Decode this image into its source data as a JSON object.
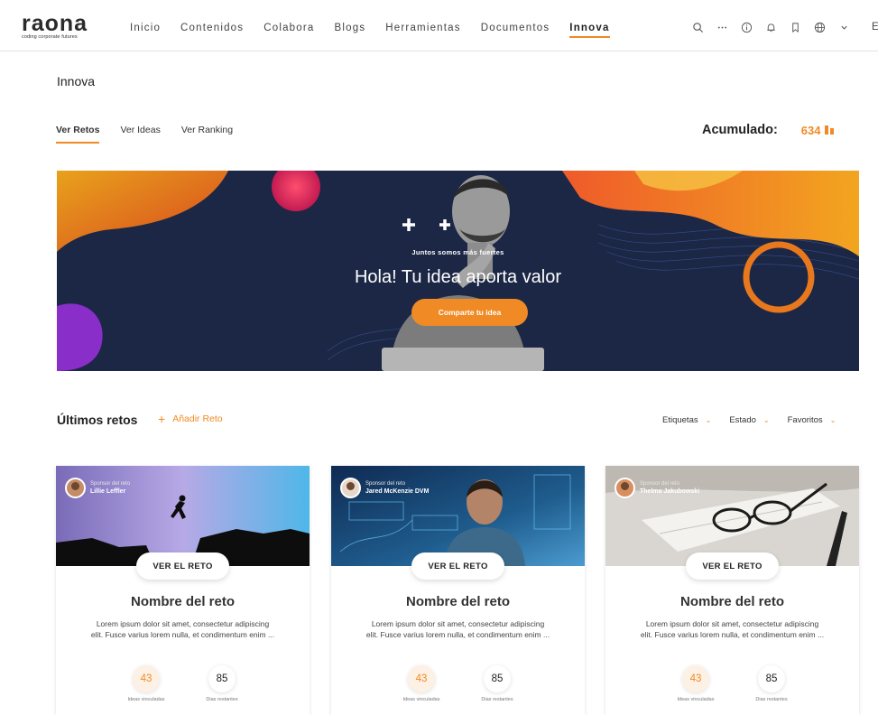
{
  "brand": {
    "name": "raona",
    "tagline": "coding corporate futures"
  },
  "nav": {
    "items": [
      "Inicio",
      "Contenidos",
      "Colabora",
      "Blogs",
      "Herramientas",
      "Documentos",
      "Innova"
    ],
    "active": "Innova",
    "icons": [
      "search-icon",
      "more-icon",
      "info-icon",
      "bell-icon",
      "bookmark-icon",
      "globe-icon",
      "chevron-down-icon"
    ],
    "lang": "E"
  },
  "page": {
    "title": "Innova",
    "tabs": [
      "Ver Retos",
      "Ver Ideas",
      "Ver Ranking"
    ],
    "active_tab": "Ver Retos",
    "acumulado_label": "Acumulado:",
    "acumulado_value": "634"
  },
  "hero": {
    "subtitle": "Juntos somos más fuertes",
    "title": "Hola! Tu idea aporta valor",
    "button": "Comparte tu idea"
  },
  "section": {
    "title": "Últimos retos",
    "add_label": "Añadir Reto",
    "filters": [
      "Etiquetas",
      "Estado",
      "Favoritos"
    ]
  },
  "cards": [
    {
      "sponsor_label": "Sponsor del reto",
      "sponsor_name": "Lillie Leffler",
      "button": "VER EL RETO",
      "title": "Nombre del reto",
      "description": "Lorem ipsum dolor sit amet, consectetur adipiscing elit. Fusce varius lorem nulla, et condimentum enim ...",
      "ideas": "43",
      "ideas_label": "Ideas vinculadas",
      "days": "85",
      "days_label": "Dias restantes"
    },
    {
      "sponsor_label": "Sponsor del reto",
      "sponsor_name": "Jared McKenzie DVM",
      "button": "VER EL RETO",
      "title": "Nombre del reto",
      "description": "Lorem ipsum dolor sit amet, consectetur adipiscing elit. Fusce varius lorem nulla, et condimentum enim ...",
      "ideas": "43",
      "ideas_label": "Ideas vinculadas",
      "days": "85",
      "days_label": "Dias restantes"
    },
    {
      "sponsor_label": "Sponsor del reto",
      "sponsor_name": "Thelma Jakubowski",
      "button": "VER EL RETO",
      "title": "Nombre del reto",
      "description": "Lorem ipsum dolor sit amet, consectetur adipiscing elit. Fusce varius lorem nulla, et condimentum enim ...",
      "ideas": "43",
      "ideas_label": "Ideas vinculadas",
      "days": "85",
      "days_label": "Dias restantes"
    }
  ],
  "colors": {
    "accent": "#f08a24",
    "hero_bg": "#1c2746"
  }
}
